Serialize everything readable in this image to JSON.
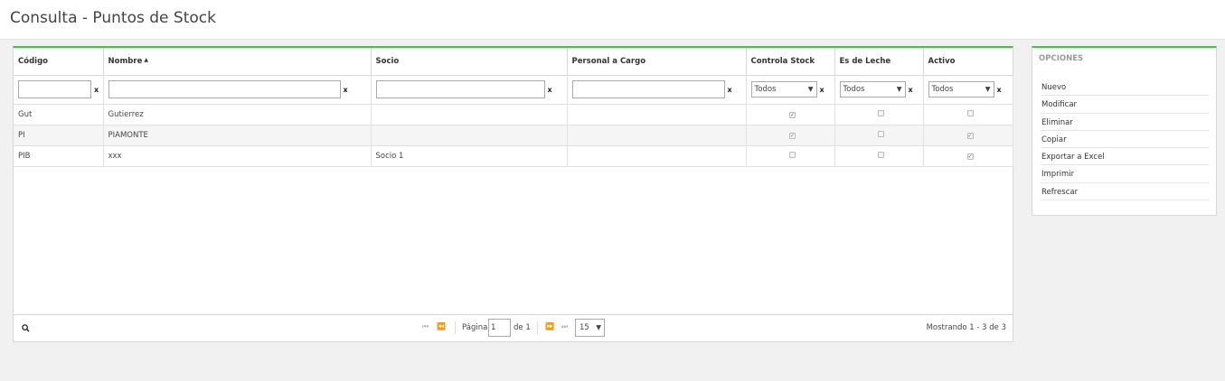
{
  "page": {
    "title": "Consulta - Puntos de Stock"
  },
  "grid": {
    "columns": [
      "Código",
      "Nombre",
      "Socio",
      "Personal a Cargo",
      "Controla Stock",
      "Es de Leche",
      "Activo"
    ],
    "filters": {
      "clear_label": "x",
      "select_value": "Todos"
    },
    "rows": [
      {
        "codigo": "Gut",
        "nombre": "Gutierrez",
        "socio": "",
        "personal": "",
        "controla_stock": true,
        "es_de_leche": false,
        "activo": false
      },
      {
        "codigo": "PI",
        "nombre": "PIAMONTE",
        "socio": "",
        "personal": "",
        "controla_stock": true,
        "es_de_leche": false,
        "activo": true
      },
      {
        "codigo": "PIB",
        "nombre": "xxx",
        "socio": "Socio 1",
        "personal": "",
        "controla_stock": false,
        "es_de_leche": false,
        "activo": true
      }
    ]
  },
  "pager": {
    "page_label": "Página",
    "page_value": "1",
    "of_label": "de 1",
    "page_size": "15",
    "showing": "Mostrando 1 - 3 de 3"
  },
  "options": {
    "title": "OPCIONES",
    "items": [
      "Nuevo",
      "Modificar",
      "Eliminar",
      "Copiar",
      "Exportar a Excel",
      "Imprimir",
      "Refrescar"
    ]
  }
}
